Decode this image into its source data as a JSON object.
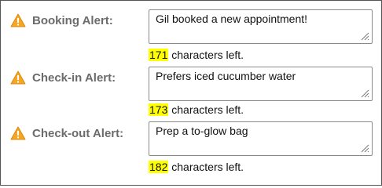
{
  "colors": {
    "label": "#6b6b6b",
    "warning_icon": "#f5a623",
    "count_highlight": "#ffff00"
  },
  "icons": {
    "warning": "warning-triangle-icon",
    "resize": "resize-grip-icon"
  },
  "alerts": [
    {
      "label": "Booking Alert:",
      "value": "Gil booked a new appointment!",
      "count": "171",
      "count_suffix": " characters left."
    },
    {
      "label": "Check-in Alert:",
      "value": "Prefers iced cucumber water",
      "count": "173",
      "count_suffix": " characters left."
    },
    {
      "label": "Check-out Alert:",
      "value": "Prep a to-glow bag",
      "count": "182",
      "count_suffix": " characters left."
    }
  ]
}
